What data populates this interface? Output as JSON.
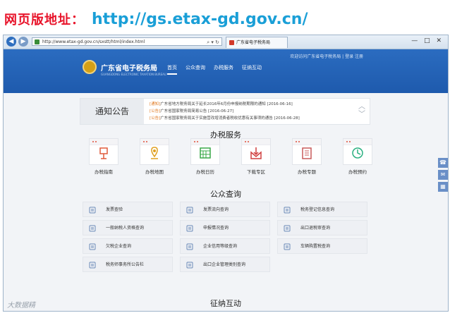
{
  "headline": {
    "label": "网页版地址：",
    "url": "http://gs.etax-gd.gov.cn/"
  },
  "browser": {
    "address": "http://www.etax-gd.gov.cn/sxstt/html/index.html",
    "tab_title": "广东省电子税务局",
    "window_controls": "— □ ✕"
  },
  "site": {
    "top_links": "欢迎访问广东省电子税务局 | 登录 注册",
    "logo_name": "广东省电子税务局",
    "logo_en": "GUANGDONG ELECTRONIC TAXATION BUREAU",
    "nav": [
      "首页",
      "公众查询",
      "办税服务",
      "征纳互动"
    ],
    "notice": {
      "title": "通知公告",
      "items": [
        {
          "tag": "[通知]",
          "text": "广东省地方税务局关于延长2016年6月份申报纳税期限的通知 [2016-06-16]"
        },
        {
          "tag": "[公告]",
          "text": "广东省国家税务局简易公告 [2016-06-27]"
        },
        {
          "tag": "[公告]",
          "text": "广东省国家税务局关于实施营改增消费者税收优惠有关事项的通告 [2016-06-28]"
        }
      ]
    },
    "services_title": "办税服务",
    "services": [
      {
        "label": "办税指南",
        "icon": "flag-icon",
        "color": "#e05a3a"
      },
      {
        "label": "办税地图",
        "icon": "map-pin-icon",
        "color": "#e0a020"
      },
      {
        "label": "办税日历",
        "icon": "calendar-icon",
        "color": "#3aa848"
      },
      {
        "label": "下载专区",
        "icon": "download-box-icon",
        "color": "#d04040"
      },
      {
        "label": "办税专题",
        "icon": "document-stack-icon",
        "color": "#c85a5a"
      },
      {
        "label": "办税预约",
        "icon": "clock-icon",
        "color": "#2ab080"
      }
    ],
    "query_title": "公众查询",
    "queries": [
      {
        "label": "发票查验",
        "icon": "check-icon"
      },
      {
        "label": "发票流向查询",
        "icon": "gear-icon"
      },
      {
        "label": "税务登记信息查询",
        "icon": "building-icon"
      },
      {
        "label": "一般纳税人资格查询",
        "icon": "gauge-icon"
      },
      {
        "label": "申报情况查询",
        "icon": "report-icon"
      },
      {
        "label": "出口退税审查询",
        "icon": "ship-icon"
      },
      {
        "label": "欠税企业查询",
        "icon": "list-icon"
      },
      {
        "label": "企业信用等级查询",
        "icon": "star-icon"
      },
      {
        "label": "车辆购置税查询",
        "icon": "car-icon"
      },
      {
        "label": "税务师事务所公告栏",
        "icon": "document-icon"
      },
      {
        "label": "出口企业管理类别查询",
        "icon": "export-icon"
      }
    ],
    "interact_title": "征纳互动"
  },
  "watermark": "大数据精"
}
